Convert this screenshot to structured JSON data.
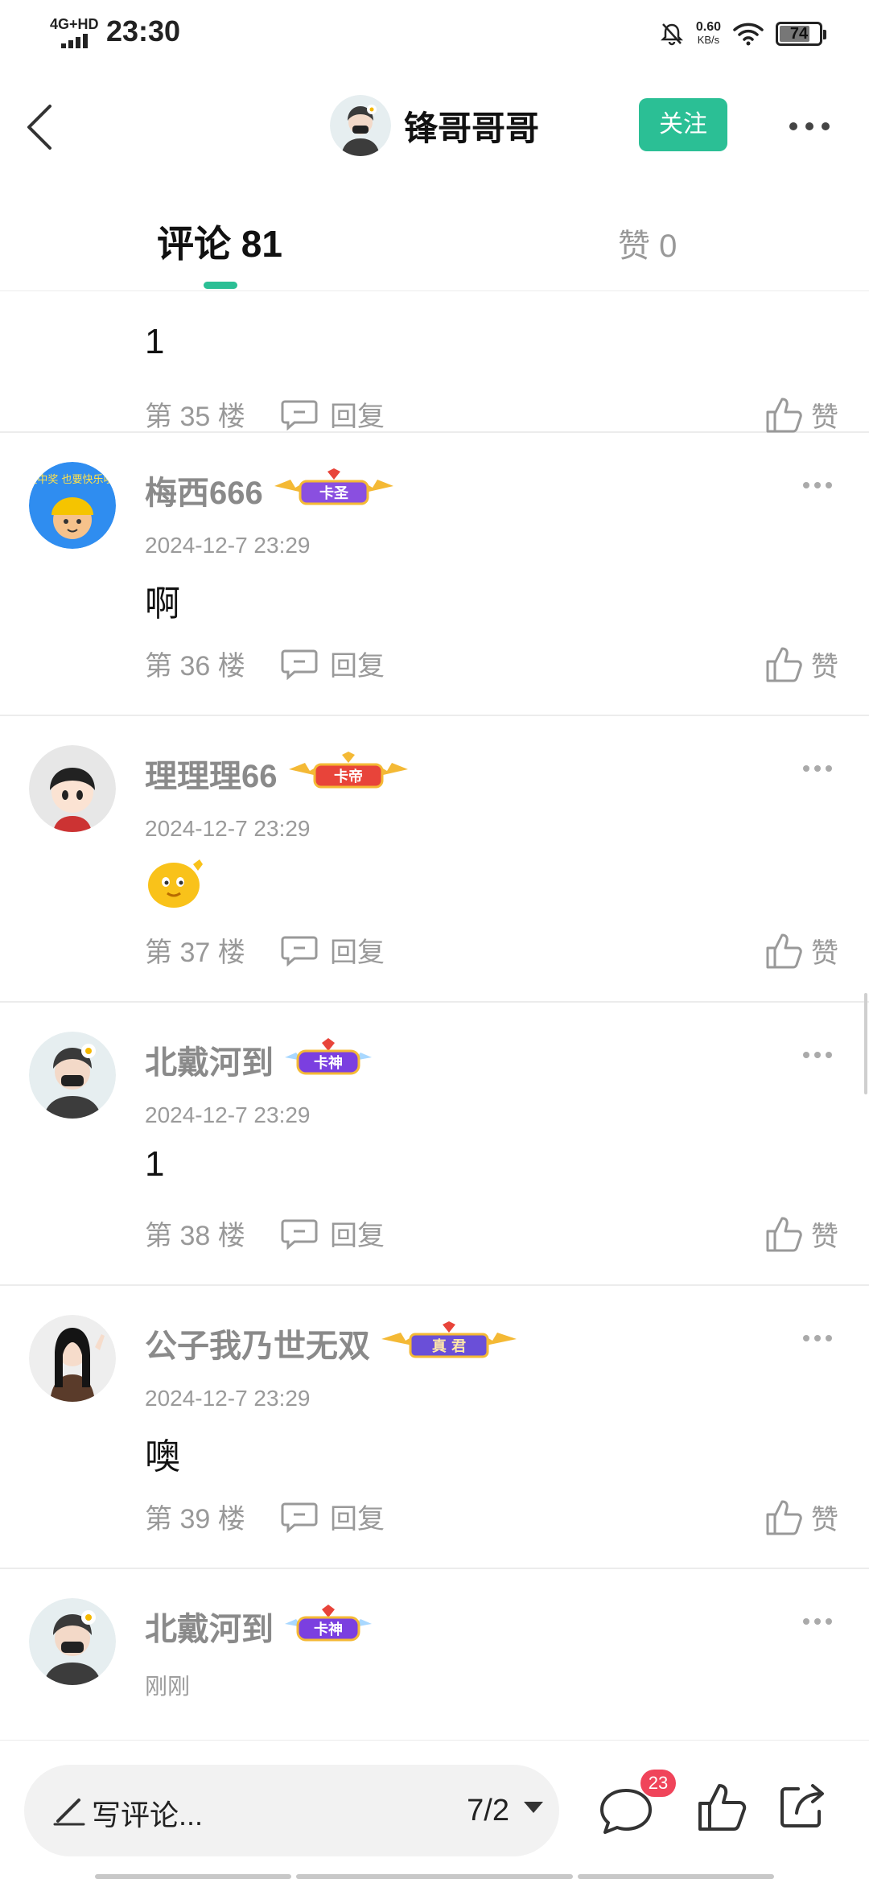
{
  "status_bar": {
    "network": "4G+HD",
    "time": "23:30",
    "speed_value": "0.60",
    "speed_unit": "KB/s",
    "battery": "74"
  },
  "header": {
    "title": "锋哥哥哥",
    "follow_label": "关注"
  },
  "tabs": {
    "comments_label": "评论 81",
    "likes_label": "赞 0"
  },
  "comments": [
    {
      "name": "",
      "time": "",
      "text": "1",
      "floor": "第 35 楼",
      "reply_label": "回复",
      "like_label": "赞"
    },
    {
      "name": "梅西666",
      "badge": "卡圣",
      "time": "2024-12-7 23:29",
      "text": "啊",
      "floor": "第 36 楼",
      "reply_label": "回复",
      "like_label": "赞",
      "avatar_text": "没中奖 也要快乐哦!"
    },
    {
      "name": "理理理66",
      "badge": "卡帝",
      "time": "2024-12-7 23:29",
      "text": "",
      "floor": "第 37 楼",
      "reply_label": "回复",
      "like_label": "赞"
    },
    {
      "name": "北戴河到",
      "badge": "卡神",
      "time": "2024-12-7 23:29",
      "text": "1",
      "floor": "第 38 楼",
      "reply_label": "回复",
      "like_label": "赞"
    },
    {
      "name": "公子我乃世无双",
      "badge": "真 君",
      "time": "2024-12-7 23:29",
      "text": "噢",
      "floor": "第 39 楼",
      "reply_label": "回复",
      "like_label": "赞"
    },
    {
      "name": "北戴河到",
      "badge": "卡神",
      "time": "刚刚"
    }
  ],
  "bottom_bar": {
    "write_placeholder": "写评论...",
    "page_indicator": "7/2",
    "comment_count_badge": "23"
  },
  "colors": {
    "accent": "#2bbf95",
    "badge_red": "#f0445a"
  }
}
